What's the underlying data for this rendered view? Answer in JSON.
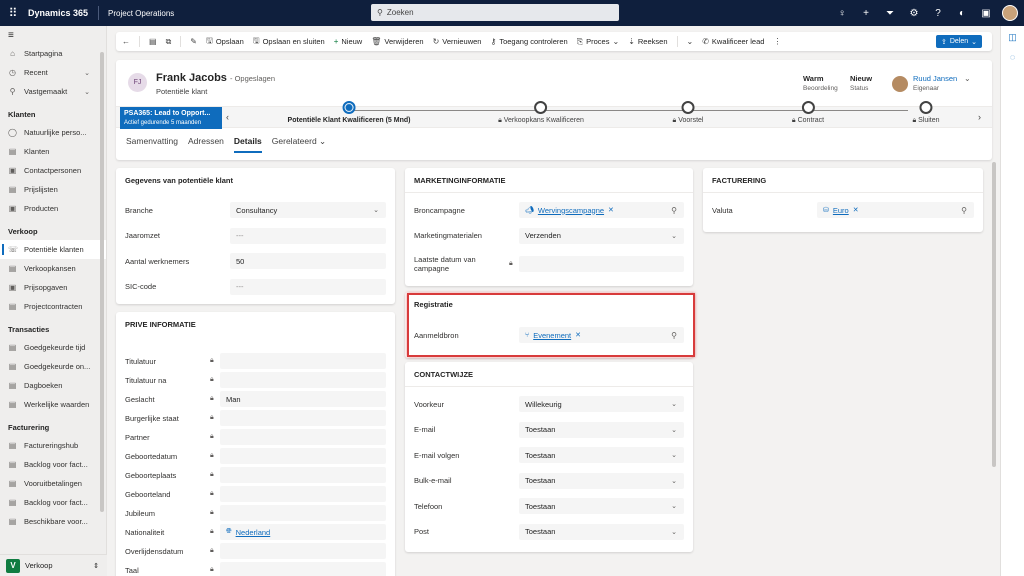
{
  "topbar": {
    "brand": "Dynamics 365",
    "app": "Project Operations",
    "search_placeholder": "Zoeken"
  },
  "nav": {
    "top": [
      {
        "label": "Startpagina",
        "icon": "⌂"
      },
      {
        "label": "Recent",
        "icon": "◷",
        "chev": "⌄"
      },
      {
        "label": "Vastgemaakt",
        "icon": "⚲",
        "chev": "⌄"
      }
    ],
    "groups": [
      {
        "title": "Klanten",
        "items": [
          "Natuurlijke perso...",
          "Klanten",
          "Contactpersonen",
          "Prijslijsten",
          "Producten"
        ]
      },
      {
        "title": "Verkoop",
        "items": [
          "Potentiële klanten",
          "Verkoopkansen",
          "Prijsopgaven",
          "Projectcontracten"
        ]
      },
      {
        "title": "Transacties",
        "items": [
          "Goedgekeurde tijd",
          "Goedgekeurde on...",
          "Dagboeken",
          "Werkelijke waarden"
        ]
      },
      {
        "title": "Facturering",
        "items": [
          "Factureringshub",
          "Backlog voor fact...",
          "Vooruitbetalingen",
          "Backlog voor fact...",
          "Beschikbare voor..."
        ]
      }
    ],
    "area_badge": "V",
    "area": "Verkoop"
  },
  "cmdbar": {
    "items": [
      "Opslaan",
      "Opslaan en sluiten",
      "Nieuw",
      "Verwijderen",
      "Vernieuwen",
      "Toegang controleren",
      "Proces",
      "Reeksen",
      "Kwalificeer lead"
    ],
    "share": "Delen"
  },
  "header": {
    "initials": "FJ",
    "name": "Frank Jacobs",
    "saved": "- Opgeslagen",
    "entity": "Potentiële klant",
    "rating_value": "Warm",
    "rating_label": "Beoordeling",
    "status_value": "Nieuw",
    "status_label": "Status",
    "owner_name": "Ruud Jansen",
    "owner_label": "Eigenaar"
  },
  "bpf": {
    "name": "PSA365: Lead to Opport...",
    "sub": "Actief gedurende 5 maanden",
    "stages": [
      "Potentiële Klant Kwalificeren  (5 Mnd)",
      "Verkoopkans Kwalificeren",
      "Voorstel",
      "Contract",
      "Sluiten"
    ]
  },
  "tabs": [
    "Samenvatting",
    "Adressen",
    "Details",
    "Gerelateerd"
  ],
  "sections": {
    "general": {
      "title": "Gegevens van potentiële klant",
      "rows": [
        {
          "label": "Branche",
          "value": "Consultancy"
        },
        {
          "label": "Jaaromzet",
          "value": "---"
        },
        {
          "label": "Aantal werknemers",
          "value": "50"
        },
        {
          "label": "SIC-code",
          "value": "---"
        }
      ]
    },
    "private": {
      "title": "PRIVE INFORMATIE",
      "rows": [
        {
          "label": "Titulatuur",
          "value": ""
        },
        {
          "label": "Titulatuur na",
          "value": ""
        },
        {
          "label": "Geslacht",
          "value": "Man"
        },
        {
          "label": "Burgerlijke staat",
          "value": ""
        },
        {
          "label": "Partner",
          "value": ""
        },
        {
          "label": "Geboortedatum",
          "value": ""
        },
        {
          "label": "Geboorteplaats",
          "value": ""
        },
        {
          "label": "Geboorteland",
          "value": ""
        },
        {
          "label": "Jubileum",
          "value": ""
        },
        {
          "label": "Nationaliteit",
          "value": "Nederland"
        },
        {
          "label": "Overlijdensdatum",
          "value": ""
        },
        {
          "label": "Taal",
          "value": ""
        }
      ]
    },
    "marketing": {
      "title": "MARKETINGINFORMATIE",
      "rows": [
        {
          "label": "Broncampagne",
          "value": "Wervingscampagne"
        },
        {
          "label": "Marketingmaterialen",
          "value": "Verzenden"
        },
        {
          "label": "Laatste datum van campagne",
          "value": ""
        }
      ]
    },
    "registration": {
      "title": "Registratie",
      "rows": [
        {
          "label": "Aanmeldbron",
          "value": "Evenement"
        }
      ]
    },
    "contact": {
      "title": "CONTACTWIJZE",
      "rows": [
        {
          "label": "Voorkeur",
          "value": "Willekeurig"
        },
        {
          "label": "E-mail",
          "value": "Toestaan"
        },
        {
          "label": "E-mail volgen",
          "value": "Toestaan"
        },
        {
          "label": "Bulk-e-mail",
          "value": "Toestaan"
        },
        {
          "label": "Telefoon",
          "value": "Toestaan"
        },
        {
          "label": "Post",
          "value": "Toestaan"
        }
      ]
    },
    "billing": {
      "title": "FACTURERING",
      "rows": [
        {
          "label": "Valuta",
          "value": "Euro"
        }
      ]
    }
  },
  "colors": {
    "topbar": "#0f1f3d",
    "accent": "#0f6cbd",
    "highlight": "#d83b3b"
  }
}
